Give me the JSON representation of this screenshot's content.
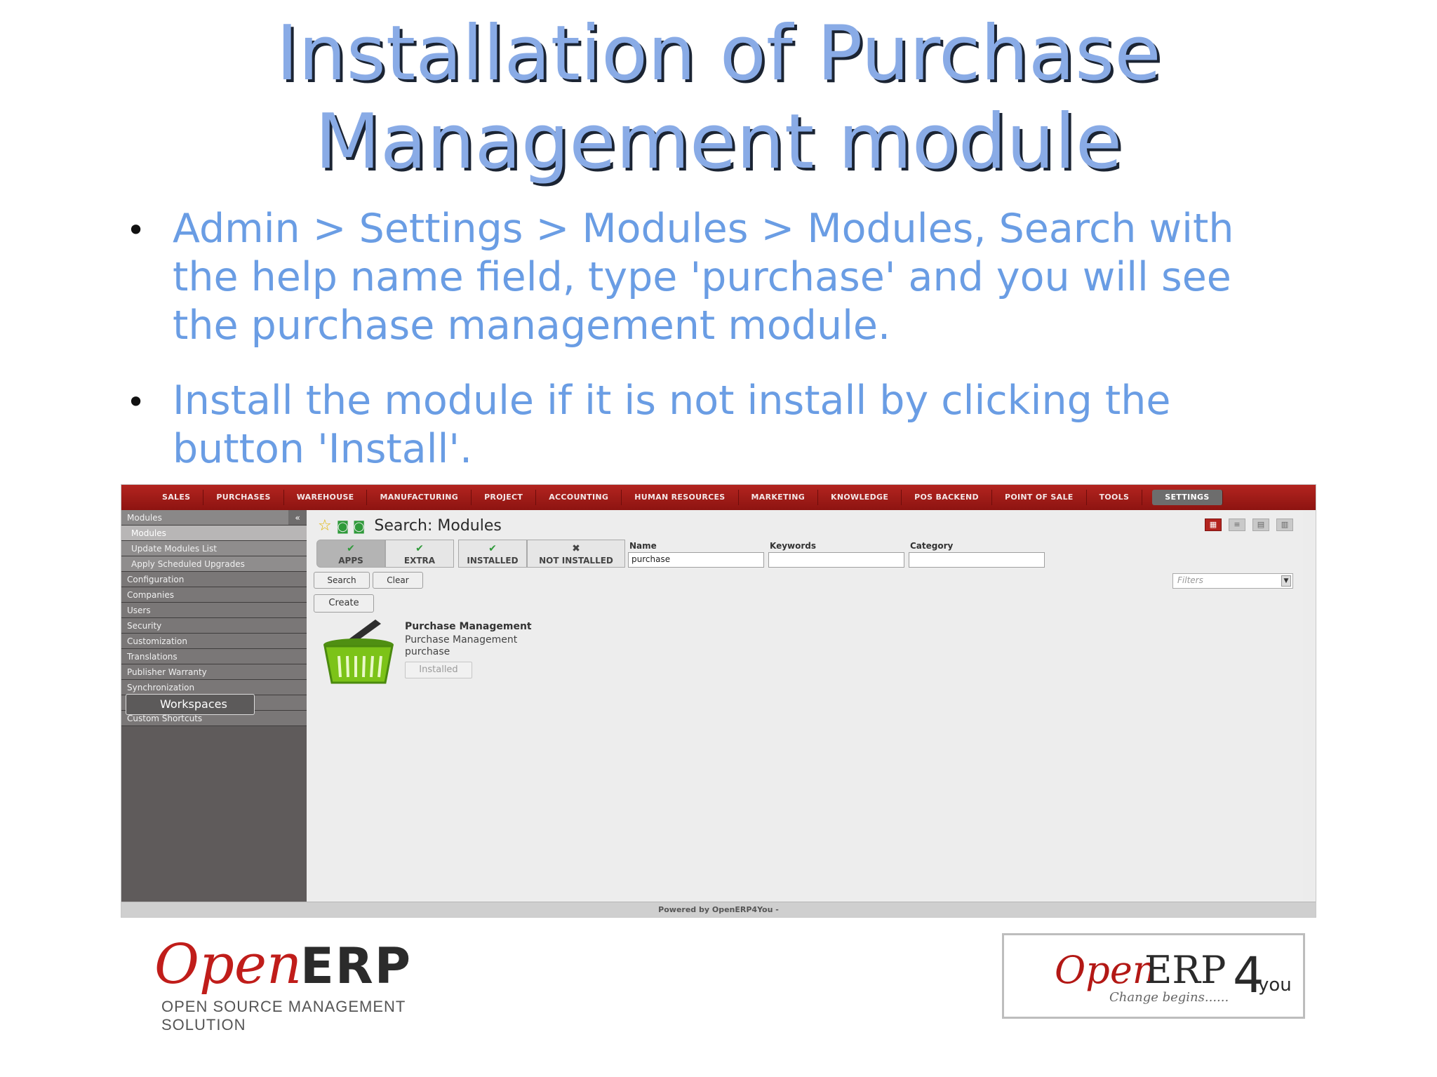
{
  "slide": {
    "title_line1": "Installation of Purchase",
    "title_line2": "Management module",
    "bullets": [
      "Admin > Settings > Modules > Modules, Search with the help name field, type 'purchase' and you will see the purchase management module.",
      "Install the module if it is not install by clicking the button 'Install'."
    ]
  },
  "app": {
    "menu": [
      "SALES",
      "PURCHASES",
      "WAREHOUSE",
      "MANUFACTURING",
      "PROJECT",
      "ACCOUNTING",
      "HUMAN RESOURCES",
      "MARKETING",
      "KNOWLEDGE",
      "POS BACKEND",
      "POINT OF SALE",
      "TOOLS",
      "SETTINGS"
    ],
    "active_menu": "SETTINGS",
    "sidebar": {
      "header": "Modules",
      "collapse": "«",
      "sub_items": [
        "Modules",
        "Update Modules List",
        "Apply Scheduled Upgrades"
      ],
      "categories": [
        "Configuration",
        "Companies",
        "Users",
        "Security",
        "Customization",
        "Translations",
        "Publisher Warranty",
        "Synchronization",
        "",
        "Custom Shortcuts"
      ],
      "workspaces": "Workspaces"
    },
    "page_title": "Search: Modules",
    "filter_buttons": [
      "APPS",
      "EXTRA",
      "INSTALLED",
      "NOT INSTALLED"
    ],
    "fields": {
      "name_label": "Name",
      "name_value": "purchase",
      "keywords_label": "Keywords",
      "keywords_value": "",
      "category_label": "Category",
      "category_value": ""
    },
    "buttons": {
      "search": "Search",
      "clear": "Clear",
      "create": "Create"
    },
    "filters_placeholder": "Filters",
    "module": {
      "name": "Purchase Management",
      "short_desc": "Purchase Management",
      "technical_name": "purchase",
      "status": "Installed"
    },
    "footer": "Powered by OpenERP4You -"
  },
  "logos": {
    "left_word": "Open",
    "left_erp": "ERP",
    "left_tag": "OPEN SOURCE MANAGEMENT SOLUTION",
    "right_word": "Open",
    "right_erp": "ERP",
    "right_four": "4",
    "right_you": "you",
    "right_tag": "Change begins......"
  },
  "colors": {
    "title": "#89abe6",
    "bullet_text": "#6a9de4",
    "menubar": "#b3241f",
    "brand_red": "#c01d1a"
  }
}
